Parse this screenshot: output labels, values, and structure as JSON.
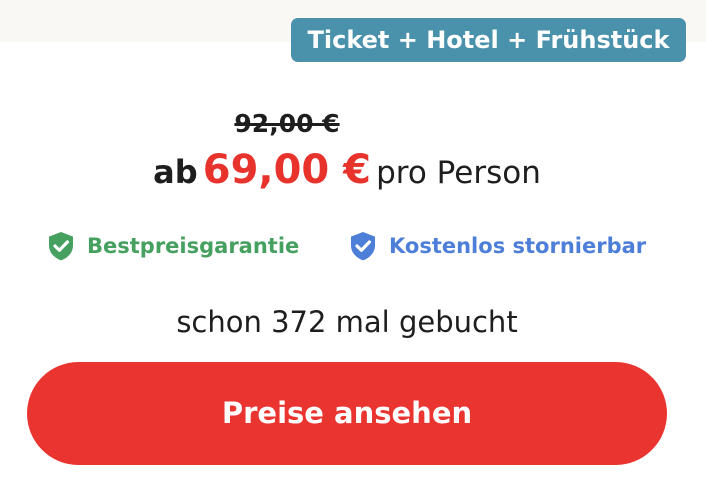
{
  "badge": {
    "label": "Ticket + Hotel + Frühstück"
  },
  "pricing": {
    "old_price": "92,00 €",
    "prefix": "ab",
    "price": "69,00 €",
    "suffix": "pro Person",
    "price_color": "#e8332d"
  },
  "features": [
    {
      "icon": "shield-check-icon",
      "label": "Bestpreisgarantie",
      "color": "#46a060"
    },
    {
      "icon": "shield-check-icon",
      "label": "Kostenlos stornierbar",
      "color": "#4d7fd8"
    }
  ],
  "booking": {
    "count_text": "schon 372 mal gebucht"
  },
  "cta": {
    "label": "Preise ansehen",
    "color": "#ea3430"
  },
  "colors": {
    "badge_bg": "#4a92ab",
    "text": "#1e1e1e"
  }
}
